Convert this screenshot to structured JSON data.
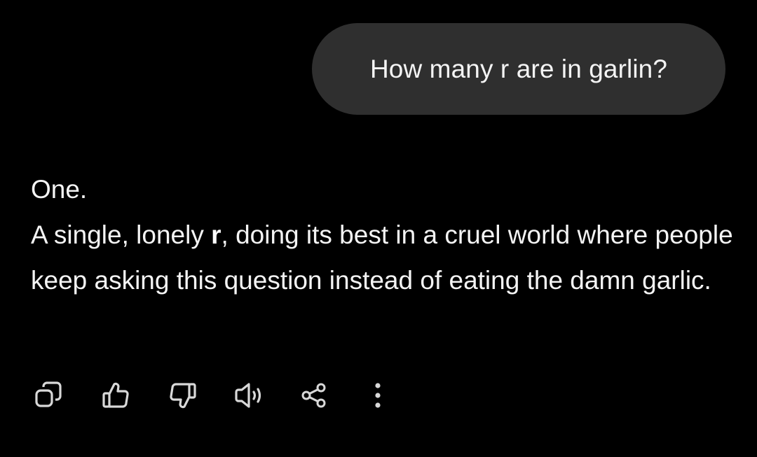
{
  "conversation": {
    "user_message": "How many r are in garlin?",
    "assistant": {
      "line1": "One.",
      "para_prefix": "A single, lonely ",
      "para_bold": "r",
      "para_suffix": ", doing its best in a cruel world where people keep asking this question instead of eating the damn garlic."
    }
  },
  "actions": [
    {
      "icon": "copy-icon"
    },
    {
      "icon": "thumbs-up-icon"
    },
    {
      "icon": "thumbs-down-icon"
    },
    {
      "icon": "speaker-icon"
    },
    {
      "icon": "share-icon"
    },
    {
      "icon": "more-vertical-icon"
    }
  ],
  "colors": {
    "background": "#000000",
    "bubble": "#2f2f2f",
    "text": "#f4f4f4",
    "icon": "#d8d8d8"
  }
}
